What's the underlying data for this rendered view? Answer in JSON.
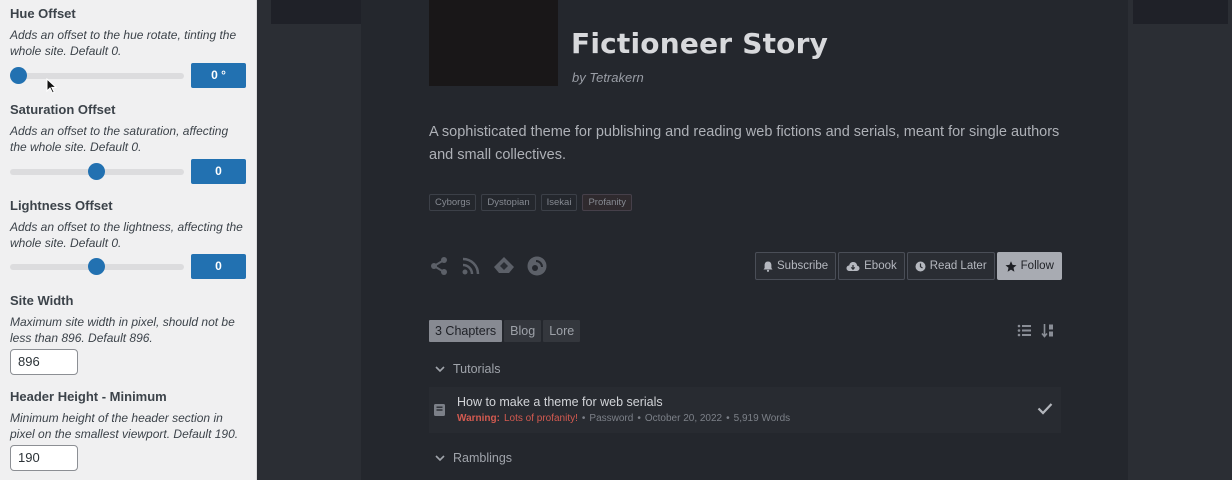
{
  "sidebar": {
    "hue": {
      "title": "Hue Offset",
      "desc": "Adds an offset to the hue rotate, tinting the whole site. Default 0.",
      "value": "0 °",
      "position": 0.0
    },
    "saturation": {
      "title": "Saturation Offset",
      "desc": "Adds an offset to the saturation, affecting the whole site. Default 0.",
      "value": "0",
      "position": 0.5
    },
    "lightness": {
      "title": "Lightness Offset",
      "desc": "Adds an offset to the lightness, affecting the whole site. Default 0.",
      "value": "0",
      "position": 0.5
    },
    "site_width": {
      "title": "Site Width",
      "desc": "Maximum site width in pixel, should not be less than 896. Default 896.",
      "value": "896"
    },
    "header_min": {
      "title": "Header Height - Minimum",
      "desc": "Minimum height of the header section in pixel on the smallest viewport. Default 190.",
      "value": "190"
    }
  },
  "story": {
    "title": "Fictioneer Story",
    "author": "by Tetrakern",
    "description": "A sophisticated theme for publishing and reading web fictions and serials, meant for single authors and small collectives.",
    "tags": [
      "Cyborgs",
      "Dystopian",
      "Isekai",
      "Profanity"
    ]
  },
  "actions": {
    "subscribe": "Subscribe",
    "ebook": "Ebook",
    "read_later": "Read Later",
    "follow": "Follow"
  },
  "tabs": [
    "3 Chapters",
    "Blog",
    "Lore"
  ],
  "groups": {
    "tutorials": "Tutorials",
    "ramblings": "Ramblings"
  },
  "chapter": {
    "title": "How to make a theme for web serials",
    "warning_label": "Warning:",
    "warning_text": "Lots of profanity!",
    "meta_password": "Password",
    "meta_date": "October 20, 2022",
    "meta_words": "5,919 Words",
    "sep": "•"
  },
  "colors": {
    "accent": "#2271b1",
    "warning": "#d35a50",
    "follow_button": "#a8abb2"
  }
}
